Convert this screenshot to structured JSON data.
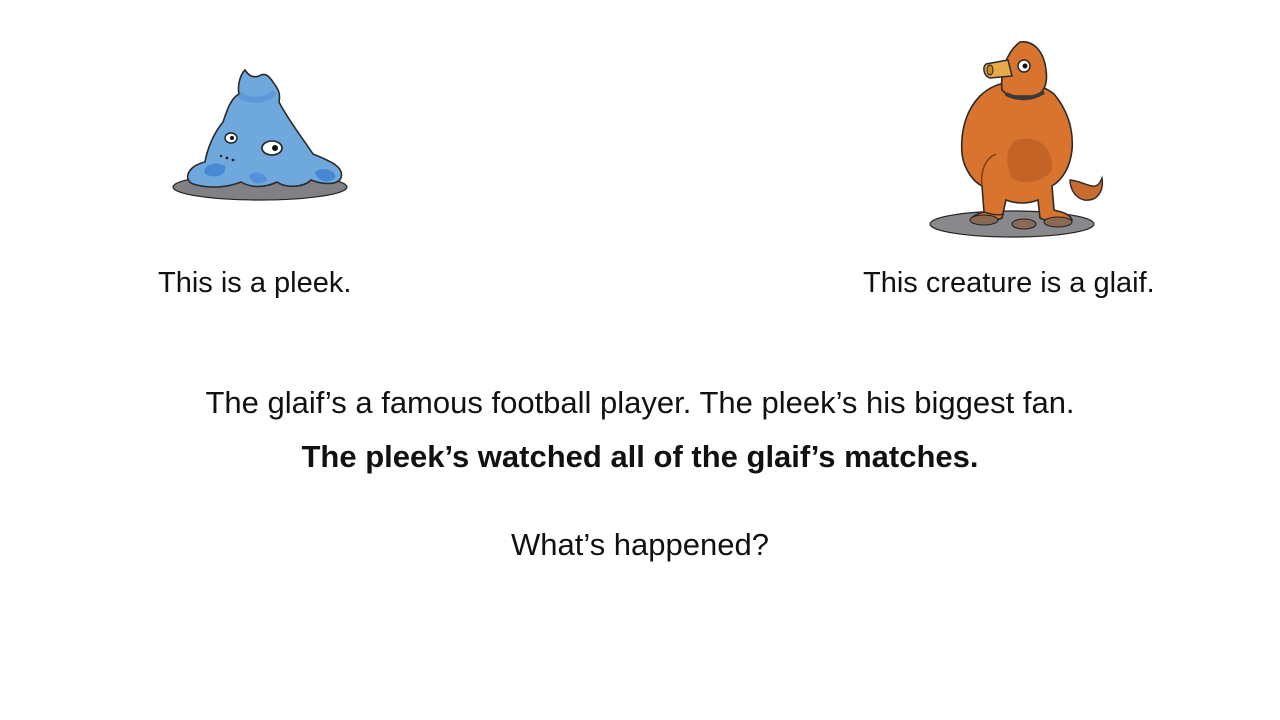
{
  "creatures": {
    "pleek": {
      "caption": "This is a pleek.",
      "icon": "blue-blob-creature-icon",
      "color": "#5b9bd5"
    },
    "glaif": {
      "caption": "This creature is a glaif.",
      "icon": "orange-snouted-creature-icon",
      "color": "#d2691e"
    }
  },
  "story": {
    "context": "The glaif’s a famous football player. The pleek’s his biggest fan.",
    "target": "The pleek’s watched all of the glaif’s matches.",
    "question": "What’s happened?"
  }
}
